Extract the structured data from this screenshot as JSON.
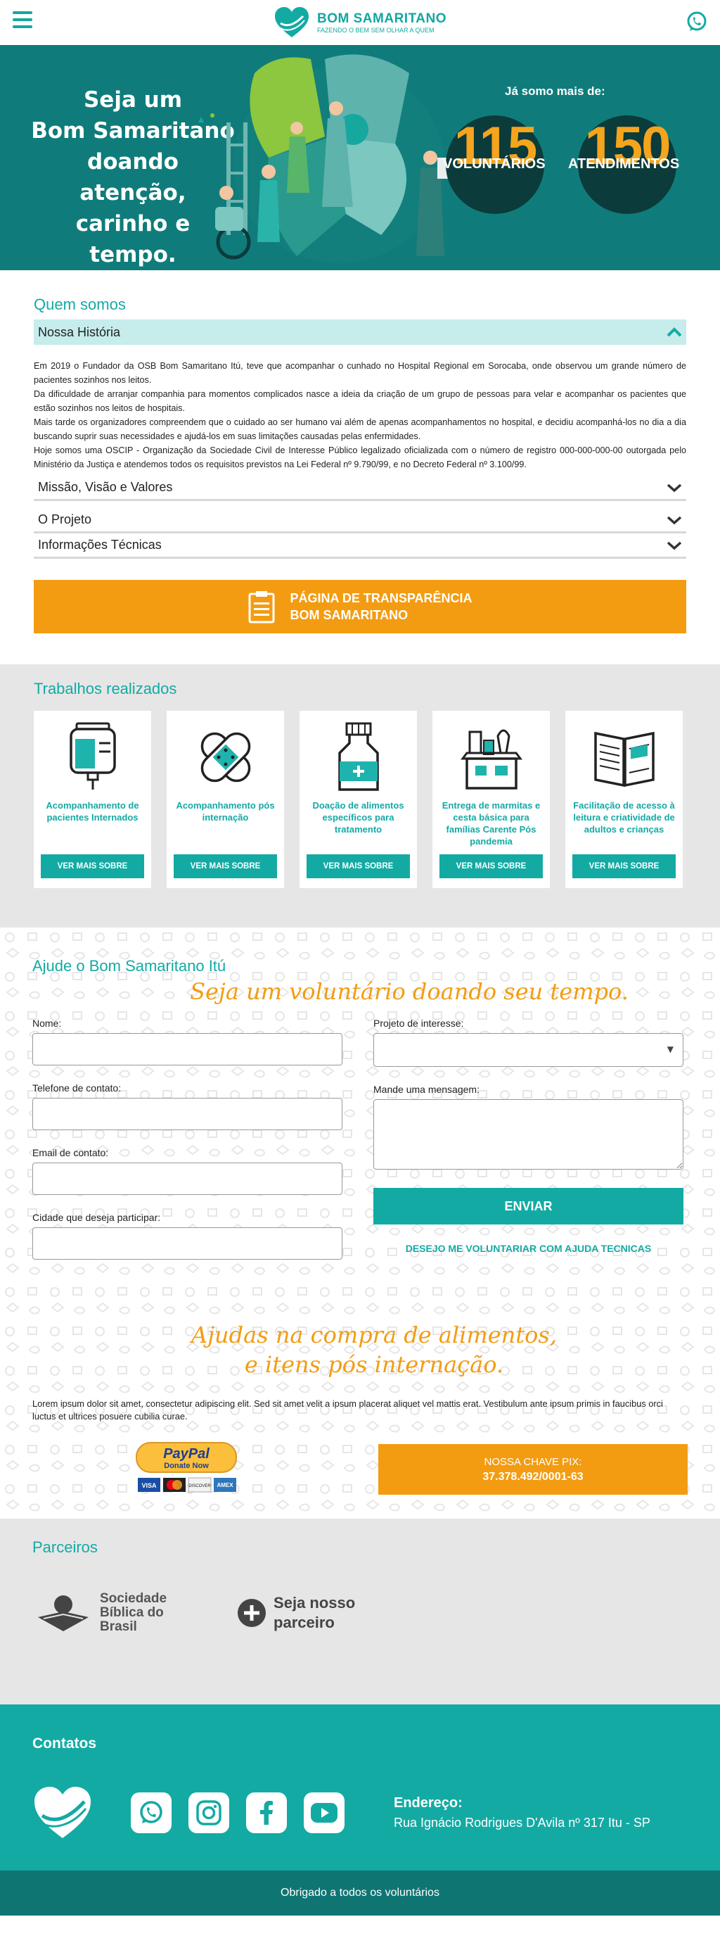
{
  "header": {
    "logo_title": "BOM SAMARITANO",
    "logo_subtitle": "FAZENDO O BEM SEM OLHAR A QUEM",
    "menu_icon": "hamburger-menu-icon",
    "whatsapp_icon": "whatsapp-icon"
  },
  "hero": {
    "title_line1": "Seja um",
    "title_line2": "Bom Samaritano",
    "title_line3": "doando atenção,",
    "title_line4": "carinho e tempo.",
    "already": "Já somo mais de:",
    "stats": [
      {
        "value": "115",
        "label": "VOLUNTÁRIOS"
      },
      {
        "value": "150",
        "label": "ATENDIMENTOS"
      }
    ]
  },
  "about": {
    "title": "Quem somos",
    "sections": [
      {
        "title": "Nossa História",
        "open": true
      },
      {
        "title": "Missão, Visão e Valores",
        "open": false
      },
      {
        "title": "O Projeto",
        "open": false
      },
      {
        "title": "Informações Técnicas",
        "open": false
      }
    ],
    "history_paragraphs": [
      "Em 2019 o Fundador da OSB Bom Samaritano Itú, teve que acompanhar o cunhado no Hospital Regional em Sorocaba, onde observou um grande número de pacientes sozinhos nos leitos.",
      "Da dificuldade de arranjar companhia para momentos complicados nasce a ideia da criação de um grupo de pessoas para velar e acompanhar os pacientes que estão sozinhos nos leitos de hospitais.",
      "Mais tarde os organizadores compreendem que o cuidado ao ser humano vai além de apenas acompanhamentos no hospital, e decidiu acompanhá-los no dia a dia buscando suprir suas necessidades e ajudá-los em suas limitações causadas pelas enfermidades.",
      "Hoje somos uma OSCIP - Organização da Sociedade Civil de Interesse Público legalizado oficializada com o número de registro 000-000-000-00 outorgada pelo Ministério da Justiça e atendemos todos os requisitos previstos na Lei Federal nº 9.790/99, e no Decreto Federal nº 3.100/99."
    ],
    "transparency_line1": "PÁGINA DE TRANSPARÊNCIA",
    "transparency_line2": "BOM SAMARITANO"
  },
  "works": {
    "title": "Trabalhos realizados",
    "button_label": "VER MAIS SOBRE",
    "cards": [
      {
        "title": "Acompanhamento de pacientes Internados",
        "icon": "iv-bag-icon"
      },
      {
        "title": "Acompanhamento pós internação",
        "icon": "bandage-icon"
      },
      {
        "title": "Doação de alimentos específicos para tratamento",
        "icon": "medicine-bottle-icon"
      },
      {
        "title": "Entrega de marmitas e cesta básica para famílias Carente Pós pandemia",
        "icon": "food-box-icon"
      },
      {
        "title": "Facilitação de acesso à leitura e criatividade de adultos e crianças",
        "icon": "open-book-icon"
      }
    ]
  },
  "help": {
    "title": "Ajude o Bom Samaritano Itú",
    "volunteer_tagline": "Seja um voluntário doando seu tempo.",
    "form": {
      "name_label": "Nome:",
      "phone_label": "Telefone de contato:",
      "email_label": "Email de contato:",
      "city_label": "Cidade que deseja participar:",
      "project_label": "Projeto de interesse:",
      "message_label": "Mande uma mensagem:",
      "send_label": "ENVIAR",
      "tech_link": "DESEJO  ME VOLUNTARIAR COM AJUDA TECNICAS"
    },
    "food_tagline_line1": "Ajudas na compra de alimentos,",
    "food_tagline_line2": "e itens pós internação.",
    "lorem": "Lorem ipsum dolor sit amet, consectetur adipiscing elit. Sed sit amet velit a ipsum placerat aliquet vel mattis erat. Vestibulum ante ipsum primis in faucibus orci luctus et ultrices posuere cubilia curae.",
    "paypal_brand": "PayPal",
    "paypal_button": "Donate Now",
    "card_brands": [
      "VISA",
      "MC",
      "DISCOVER",
      "AMEX"
    ],
    "pix_label": "NOSSA CHAVE PIX:",
    "pix_key": "37.378.492/0001-63"
  },
  "partners": {
    "title": "Parceiros",
    "partner_line1": "Sociedade",
    "partner_line2": "Bíblica do",
    "partner_line3": "Brasil",
    "cta_line1": "Seja nosso",
    "cta_line2": "parceiro"
  },
  "contacts": {
    "title": "Contatos",
    "social_icons": [
      "whatsapp-icon",
      "instagram-icon",
      "facebook-icon",
      "youtube-icon"
    ],
    "address_title": "Endereço:",
    "address_line": "Rua Ignácio Rodrigues D'Avila nº 317 Itu - SP"
  },
  "footer": {
    "text": "Obrigado a todos os voluntários"
  },
  "colors": {
    "teal": "#13aaa4",
    "dark_teal": "#0f7c7b",
    "orange": "#f39c12",
    "stat_circle": "#0b3b3a"
  }
}
